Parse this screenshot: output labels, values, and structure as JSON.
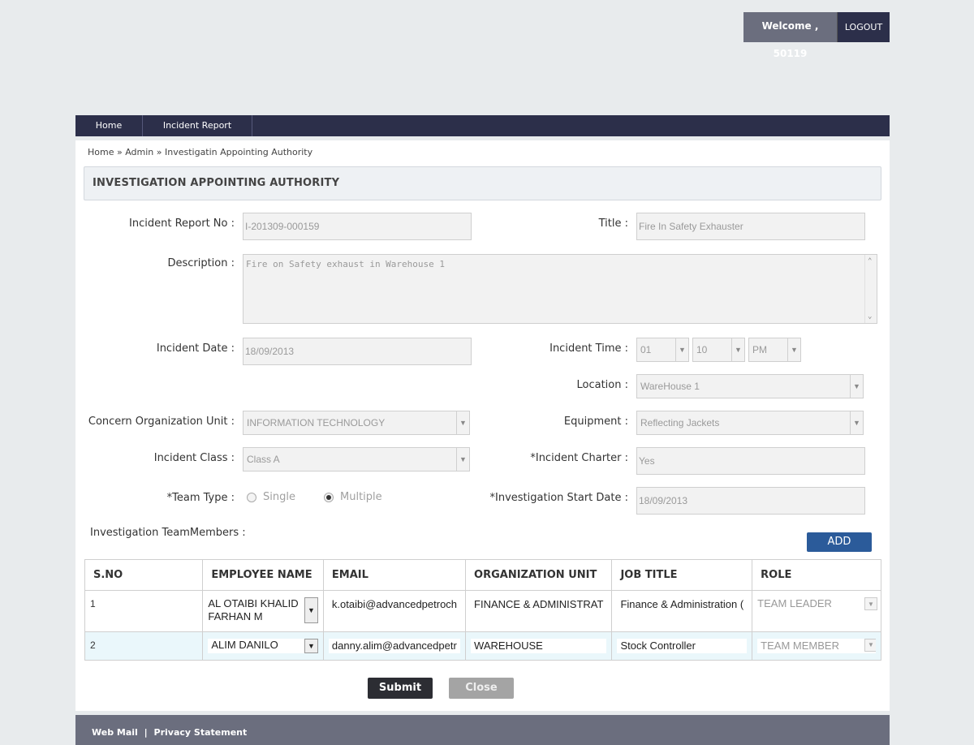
{
  "header": {
    "welcome": "Welcome , 50119",
    "logout": "LOGOUT"
  },
  "nav": {
    "home": "Home",
    "incident_report": "Incident Report"
  },
  "breadcrumb": "Home » Admin » Investigatin Appointing Authority",
  "section_title": "INVESTIGATION APPOINTING AUTHORITY",
  "form": {
    "incident_report_no": {
      "label": "Incident Report No :",
      "value": "I-201309-000159"
    },
    "title": {
      "label": "Title :",
      "value": "Fire In Safety Exhauster"
    },
    "description": {
      "label": "Description :",
      "value": "Fire on Safety exhaust in Warehouse 1"
    },
    "incident_date": {
      "label": "Incident Date :",
      "value": "18/09/2013"
    },
    "incident_time": {
      "label": "Incident Time :",
      "hour": "01",
      "minute": "10",
      "ampm": "PM"
    },
    "location": {
      "label": "Location :",
      "value": "WareHouse 1"
    },
    "org_unit": {
      "label": "Concern Organization Unit :",
      "value": "INFORMATION TECHNOLOGY"
    },
    "equipment": {
      "label": "Equipment :",
      "value": "Reflecting Jackets"
    },
    "incident_class": {
      "label": "Incident Class :",
      "value": "Class A"
    },
    "incident_charter": {
      "label": "*Incident Charter :",
      "value": "Yes"
    },
    "team_type": {
      "label": "*Team Type :",
      "single": "Single",
      "multiple": "Multiple",
      "selected": "multiple"
    },
    "start_date": {
      "label": "*Investigation Start Date :",
      "value": "18/09/2013"
    },
    "team_members_label": "Investigation TeamMembers :",
    "add": "ADD"
  },
  "table": {
    "headers": [
      "S.NO",
      "EMPLOYEE NAME",
      "EMAIL",
      "ORGANIZATION UNIT",
      "JOB TITLE",
      "ROLE"
    ],
    "rows": [
      {
        "sno": "1",
        "name": "AL OTAIBI KHALID FARHAN M",
        "email": "k.otaibi@advancedpetroch",
        "org": "FINANCE & ADMINISTRAT",
        "job": "Finance & Administration (",
        "role": "TEAM LEADER"
      },
      {
        "sno": "2",
        "name": "ALIM DANILO",
        "email": "danny.alim@advancedpetr",
        "org": "WAREHOUSE",
        "job": "Stock Controller",
        "role": "TEAM MEMBER"
      }
    ]
  },
  "buttons": {
    "submit": "Submit",
    "close": "Close"
  },
  "footer": {
    "webmail": "Web Mail",
    "sep": "|",
    "privacy": "Privacy Statement"
  }
}
